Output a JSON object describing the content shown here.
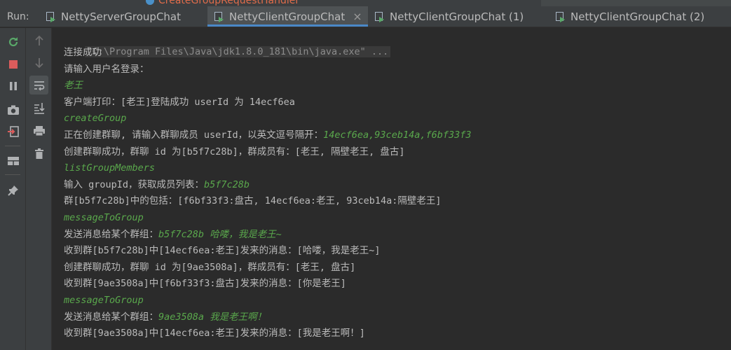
{
  "editor_peek": {
    "tab_label": "CreateGroupRequestHandler"
  },
  "run_panel": {
    "label": "Run:",
    "tabs": [
      {
        "label": "NettyServerGroupChat",
        "active": false
      },
      {
        "label": "NettyClientGroupChat",
        "active": true
      },
      {
        "label": "NettyClientGroupChat (1)",
        "active": false
      },
      {
        "label": "NettyClientGroupChat (2)",
        "active": false
      }
    ],
    "close_glyph": "×"
  },
  "toolbar": {
    "primary": [
      "rerun-icon",
      "stop-icon",
      "pause-icon",
      "camera-icon",
      "restore-layout-icon",
      "layout-icon",
      "pin-icon"
    ],
    "secondary": [
      "up-arrow-icon",
      "down-arrow-icon",
      "soft-wrap-icon",
      "scroll-to-end-icon",
      "print-icon",
      "trash-icon"
    ]
  },
  "console": {
    "command": "\"C:\\Program Files\\Java\\jdk1.8.0_181\\bin\\java.exe\" ...",
    "lines": [
      {
        "text": "连接成功"
      },
      {
        "text": "请输入用户名登录："
      },
      {
        "input": "老王"
      },
      {
        "text": "客户端打印：[老王]登陆成功 userId 为 14ecf6ea"
      },
      {
        "input": "createGroup"
      },
      {
        "text": "正在创建群聊, 请输入群聊成员 userId，以英文逗号隔开：",
        "input": "14ecf6ea,93ceb14a,f6bf33f3"
      },
      {
        "text": "创建群聊成功，群聊 id 为[b5f7c28b]，群成员有：[老王, 隔壁老王, 盘古]"
      },
      {
        "input": "listGroupMembers"
      },
      {
        "text": "输入 groupId，获取成员列表：",
        "input": "b5f7c28b"
      },
      {
        "text": "群[b5f7c28b]中的包括：[f6bf33f3:盘古, 14ecf6ea:老王, 93ceb14a:隔壁老王]"
      },
      {
        "input": "messageToGroup"
      },
      {
        "text": "发送消息给某个群组：",
        "input": "b5f7c28b 哈喽，我是老王~"
      },
      {
        "text": "收到群[b5f7c28b]中[14ecf6ea:老王]发来的消息：[哈喽，我是老王~]"
      },
      {
        "text": "创建群聊成功，群聊 id 为[9ae3508a]，群成员有：[老王, 盘古]"
      },
      {
        "text": "收到群[9ae3508a]中[f6bf33f3:盘古]发来的消息：[你是老王]"
      },
      {
        "input": "messageToGroup"
      },
      {
        "text": "发送消息给某个群组：",
        "input": "9ae3508a 我是老王啊！"
      },
      {
        "text": "收到群[9ae3508a]中[14ecf6ea:老王]发来的消息：[我是老王啊！]"
      }
    ]
  },
  "colors": {
    "background": "#2b2b2b",
    "output_text": "#bbbbbb",
    "user_input": "#5aa84c",
    "active_tab_underline": "#4a88c7"
  }
}
